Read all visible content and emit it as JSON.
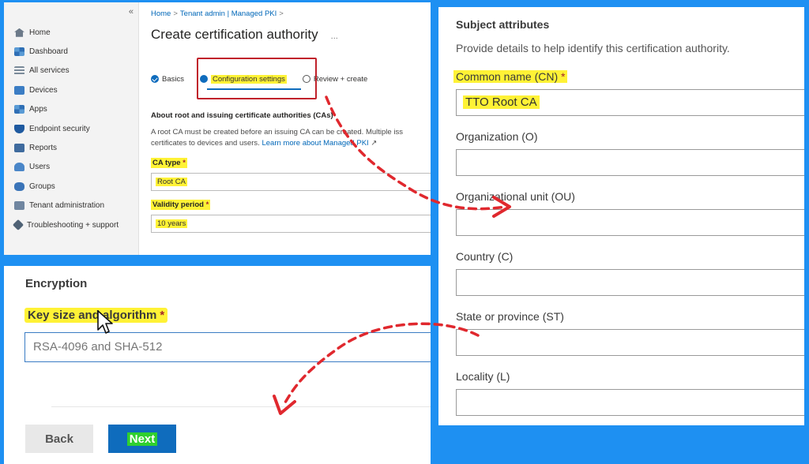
{
  "intune": {
    "sidebar": {
      "collapse_glyph": "«",
      "items": [
        {
          "label": "Home",
          "icon": "home-icon"
        },
        {
          "label": "Dashboard",
          "icon": "dashboard-icon"
        },
        {
          "label": "All services",
          "icon": "list-icon"
        },
        {
          "label": "Devices",
          "icon": "devices-icon"
        },
        {
          "label": "Apps",
          "icon": "apps-icon"
        },
        {
          "label": "Endpoint security",
          "icon": "shield-icon"
        },
        {
          "label": "Reports",
          "icon": "reports-icon"
        },
        {
          "label": "Users",
          "icon": "users-icon"
        },
        {
          "label": "Groups",
          "icon": "groups-icon"
        },
        {
          "label": "Tenant administration",
          "icon": "tenant-icon"
        },
        {
          "label": "Troubleshooting + support",
          "icon": "wrench-icon"
        }
      ]
    },
    "breadcrumb": [
      "Home",
      "Tenant admin | Managed PKI"
    ],
    "breadcrumb_sep": ">",
    "page_title": "Create certification authority",
    "more_glyph": "...",
    "tabs": [
      {
        "label": "Basics",
        "state": "done"
      },
      {
        "label": "Configuration settings",
        "state": "active"
      },
      {
        "label": "Review + create",
        "state": "pending"
      }
    ],
    "section_heading": "About root and issuing certificate authorities (CAs)",
    "description": "A root CA must be created before an issuing CA can be created. Multiple iss certificates to devices and users.",
    "learn_more": "Learn more about Managed PKI",
    "ca_type": {
      "label": "CA type",
      "value": "Root CA"
    },
    "validity": {
      "label": "Validity period",
      "value": "10 years"
    },
    "required_mark": "*"
  },
  "subject": {
    "heading": "Subject attributes",
    "description": "Provide details to help identify this certification authority.",
    "fields": [
      {
        "label": "Common name (CN)",
        "value": "TTO Root CA",
        "required": "*"
      },
      {
        "label": "Organization (O)",
        "value": ""
      },
      {
        "label": "Organizational unit (OU)",
        "value": ""
      },
      {
        "label": "Country (C)",
        "value": ""
      },
      {
        "label": "State or province (ST)",
        "value": ""
      },
      {
        "label": "Locality (L)",
        "value": ""
      }
    ]
  },
  "encryption": {
    "heading": "Encryption",
    "label": "Key size and algorithm",
    "required": "*",
    "value": "RSA-4096 and SHA-512",
    "back_label": "Back",
    "next_label": "Next"
  },
  "colors": {
    "background": "#1e90f2",
    "highlight": "#fff236",
    "accent": "#0f6cbd",
    "arrow": "#e0282e",
    "redbox": "#c0222b"
  }
}
